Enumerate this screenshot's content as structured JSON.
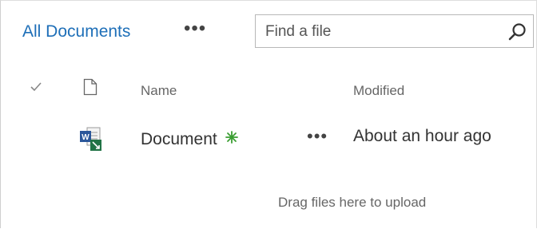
{
  "toolbar": {
    "view_title": "All Documents",
    "more_label": "•••",
    "search": {
      "placeholder": "Find a file",
      "value": ""
    }
  },
  "columns": {
    "name": "Name",
    "modified": "Modified"
  },
  "documents": [
    {
      "name": "Document",
      "modified": "About an hour ago",
      "more_label": "•••",
      "is_new": true,
      "file_type_icon": "word-document-icon"
    }
  ],
  "drop_zone": {
    "text": "Drag files here to upload"
  },
  "colors": {
    "accent": "#1e6fb8",
    "new_badge": "#3a9e32",
    "word_blue": "#2b579a",
    "excel_green": "#217346"
  }
}
